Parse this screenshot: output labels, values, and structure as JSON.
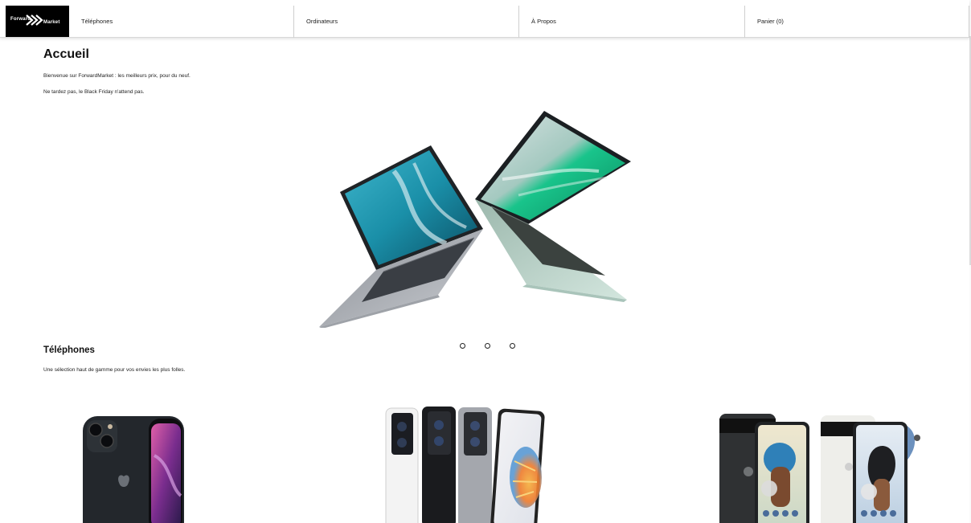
{
  "logo": {
    "part1": "Forward",
    "part2": "Market"
  },
  "nav": {
    "items": [
      {
        "label": "Téléphones"
      },
      {
        "label": "Ordinateurs"
      },
      {
        "label": "À Propos"
      },
      {
        "label": "Panier (0)"
      }
    ]
  },
  "home": {
    "title": "Accueil",
    "lines": [
      "Bienvenue sur ForwardMarket : les meilleurs prix, pour du neuf.",
      "Ne tardez pas, le Black Friday n'attend pas."
    ]
  },
  "carousel": {
    "slide_count": 3
  },
  "phones": {
    "title": "Téléphones",
    "subtitle": "Une sélection haut de gamme pour vos envies les plus folles."
  },
  "icons": {
    "logo": "double-chevron-logo-icon"
  },
  "colors": {
    "nav_bg": "#ffffff",
    "logo_bg": "#000000",
    "text": "#111111"
  }
}
